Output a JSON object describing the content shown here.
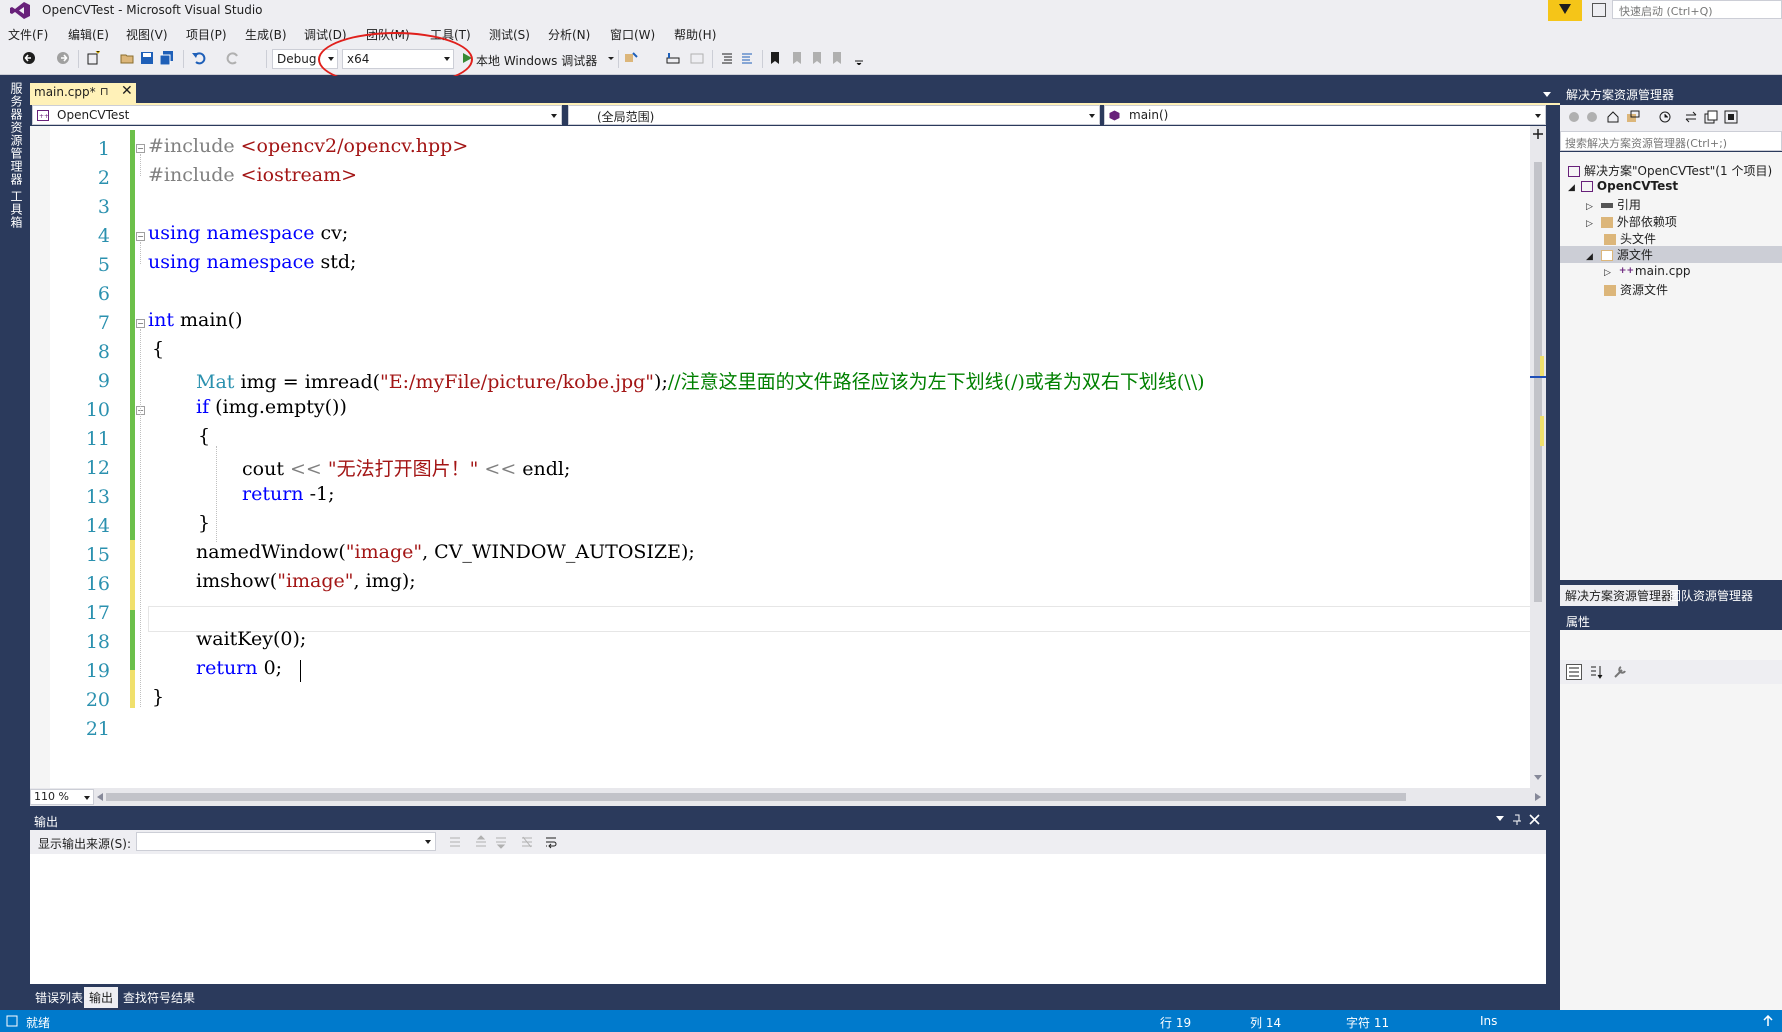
{
  "window": {
    "title": "OpenCVTest - Microsoft Visual Studio",
    "quick_launch_placeholder": "快速启动 (Ctrl+Q)"
  },
  "menu": [
    "文件(F)",
    "编辑(E)",
    "视图(V)",
    "项目(P)",
    "生成(B)",
    "调试(D)",
    "团队(M)",
    "工具(T)",
    "测试(S)",
    "分析(N)",
    "窗口(W)",
    "帮助(H)"
  ],
  "toolbar": {
    "config": "Debug",
    "platform": "x64",
    "debugger": "本地 Windows 调试器"
  },
  "left_strip": [
    "服务器资源管理器",
    "工具箱"
  ],
  "editor": {
    "tab_label": "main.cpp*",
    "pin_glyph": "⊓",
    "close_glyph": "✕",
    "nav_project": "OpenCVTest",
    "nav_scope": "(全局范围)",
    "nav_member": "main()",
    "zoom": "110 %",
    "line_numbers": [
      "1",
      "2",
      "3",
      "4",
      "5",
      "6",
      "7",
      "8",
      "9",
      "10",
      "11",
      "12",
      "13",
      "14",
      "15",
      "16",
      "17",
      "18",
      "19",
      "20",
      "21"
    ],
    "code": {
      "l1_a": "#include ",
      "l1_b": "<opencv2/opencv.hpp>",
      "l2_a": "#include ",
      "l2_b": "<iostream>",
      "l4_a": "using namespace",
      "l4_b": " cv;",
      "l5_a": "using namespace",
      "l5_b": " std;",
      "l7_a": "int",
      "l7_b": " main()",
      "l8": "{",
      "l9_a": "Mat",
      "l9_b": " img = imread(",
      "l9_c": "\"E:/myFile/picture/kobe.jpg\"",
      "l9_d": ");",
      "l9_e": "//注意这里面的文件路径应该为左下划线(/)或者为双右下划线(\\\\)",
      "l10_a": "if",
      "l10_b": " (img.empty())",
      "l11": "{",
      "l12_a": "cout ",
      "l12_b": "<<",
      "l12_c": " \"无法打开图片！\" ",
      "l12_d": "<<",
      "l12_e": " endl;",
      "l13_a": "return",
      "l13_b": " -1;",
      "l14": "}",
      "l15_a": "namedWindow(",
      "l15_b": "\"image\"",
      "l15_c": ", CV_WINDOW_AUTOSIZE);",
      "l16_a": "imshow(",
      "l16_b": "\"image\"",
      "l16_c": ", img);",
      "l18": "waitKey(0);",
      "l19_a": "return",
      "l19_b": " 0;",
      "l20": "}"
    }
  },
  "solution_explorer": {
    "title": "解决方案资源管理器",
    "search_placeholder": "搜索解决方案资源管理器(Ctrl+;)",
    "items": [
      {
        "label": "解决方案\"OpenCVTest\"(1 个项目)"
      },
      {
        "label": "OpenCVTest"
      },
      {
        "label": "引用"
      },
      {
        "label": "外部依赖项"
      },
      {
        "label": "头文件"
      },
      {
        "label": "源文件"
      },
      {
        "label": "main.cpp"
      },
      {
        "label": "资源文件"
      }
    ],
    "tabs": [
      "解决方案资源管理器",
      "团队资源管理器"
    ]
  },
  "properties": {
    "title": "属性"
  },
  "output": {
    "title": "输出",
    "source_label": "显示输出来源(S):",
    "tabs": [
      "错误列表",
      "输出",
      "查找符号结果"
    ]
  },
  "status": {
    "ready": "就绪",
    "row": "行 19",
    "col": "列 14",
    "char": "字符 11",
    "ins": "Ins"
  }
}
